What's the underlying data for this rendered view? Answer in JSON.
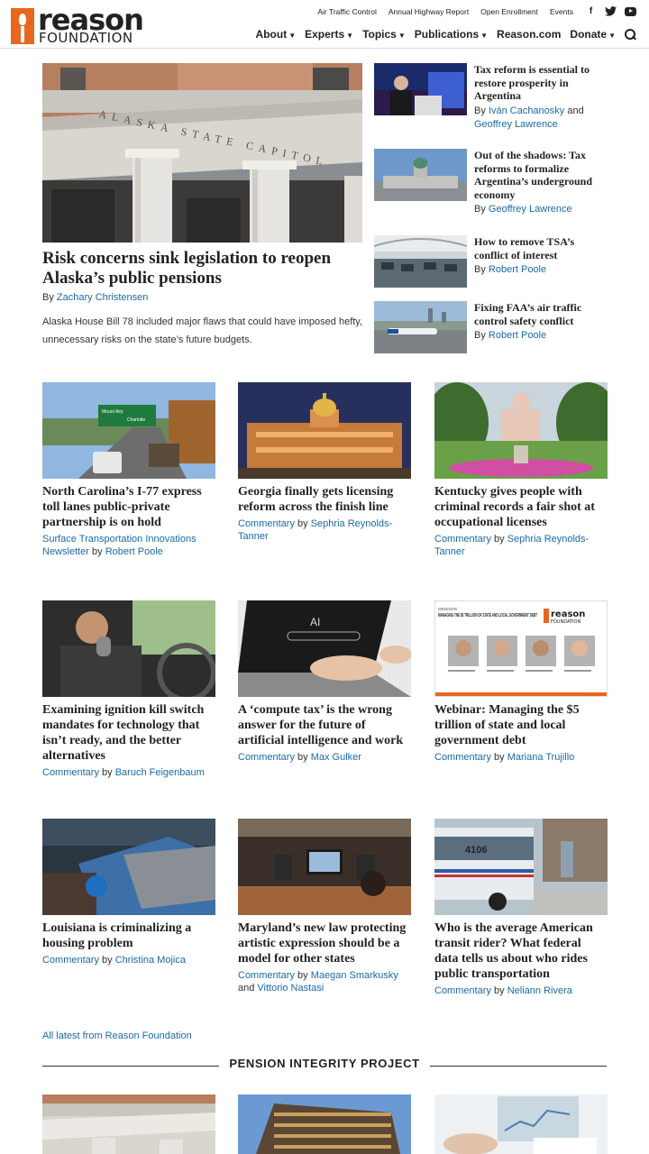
{
  "header": {
    "logo_word": "reason",
    "logo_sub": "FOUNDATION",
    "utility_links": [
      "Air Traffic Control",
      "Annual Highway Report",
      "Open Enrollment",
      "Events"
    ],
    "nav": [
      "About",
      "Experts",
      "Topics",
      "Publications",
      "Reason.com",
      "Donate"
    ]
  },
  "featured": {
    "title": "Risk concerns sink legislation to reopen Alaska’s public pensions",
    "by_prefix": "By",
    "author": "Zachary Christensen",
    "description": "Alaska House Bill 78 included major flaws that could have imposed hefty, unnecessary risks on the state’s future budgets.",
    "image_text": "ALASKA STATE CAPITOL"
  },
  "side": [
    {
      "title": "Tax reform is essential to restore prosperity in Argentina",
      "by": "By",
      "author1": "Iván Cachanosky",
      "and": "and",
      "author2": "Geoffrey Lawrence"
    },
    {
      "title": "Out of the shadows: Tax reforms to formalize Argentina’s underground economy",
      "by": "By",
      "author1": "Geoffrey Lawrence"
    },
    {
      "title": "How to remove TSA’s conflict of interest",
      "by": "By",
      "author1": "Robert Poole"
    },
    {
      "title": "Fixing FAA’s air traffic control safety conflict",
      "by": "By",
      "author1": "Robert Poole"
    }
  ],
  "grid": [
    {
      "title": "North Carolina’s I-77 express toll lanes public-private partnership is on hold",
      "category": "Surface Transportation Innovations Newsletter",
      "by": "by",
      "author": "Robert Poole"
    },
    {
      "title": "Georgia finally gets licensing reform across the finish line",
      "category": "Commentary",
      "by": "by",
      "author": "Sephria Reynolds-Tanner"
    },
    {
      "title": "Kentucky gives people with criminal records a fair shot at occupational licenses",
      "category": "Commentary",
      "by": "by",
      "author": "Sephria Reynolds-Tanner"
    },
    {
      "title": "Examining ignition kill switch mandates for technology that isn’t ready, and the better alternatives",
      "category": "Commentary",
      "by": "by",
      "author": "Baruch Feigenbaum"
    },
    {
      "title": "A ‘compute tax’ is the wrong answer for the future of artificial intelligence and work",
      "category": "Commentary",
      "by": "by",
      "author": "Max Gulker"
    },
    {
      "title": "Webinar: Managing the $5 trillion of state and local government debt",
      "category": "Commentary",
      "by": "by",
      "author": "Mariana Trujillo"
    },
    {
      "title": "Louisiana is criminalizing a housing problem",
      "category": "Commentary",
      "by": "by",
      "author": "Christina Mojica"
    },
    {
      "title": "Maryland’s new law protecting artistic expression should be a model for other states",
      "category": "Commentary",
      "by": "by",
      "author": "Maegan Smarkusky",
      "and": "and",
      "author2": "Vittorio Nastasi"
    },
    {
      "title": "Who is the average American transit rider? What federal data tells us about who rides public transportation",
      "category": "Commentary",
      "by": "by",
      "author": "Neliann Rivera"
    }
  ],
  "image_text": {
    "sign1": "Mount Airy",
    "sign2": "Charlotte",
    "ai_text": "AI",
    "webinar_tag": "WEBINAR",
    "webinar_title": "MANAGING THE $5 TRILLION OF STATE AND LOCAL GOVERNMENT DEBT",
    "webinar_logo": "reason",
    "webinar_logo_sub": "FOUNDATION",
    "bus_number": "4106"
  },
  "all_latest": "All latest from Reason Foundation",
  "section_title": "PENSION INTEGRITY PROJECT",
  "colors": {
    "link": "#1a6aa6",
    "brand_orange": "#e8671f",
    "text": "#222222"
  },
  "icons": [
    "facebook-icon",
    "twitter-icon",
    "youtube-icon",
    "search-icon",
    "chevron-down-icon"
  ]
}
